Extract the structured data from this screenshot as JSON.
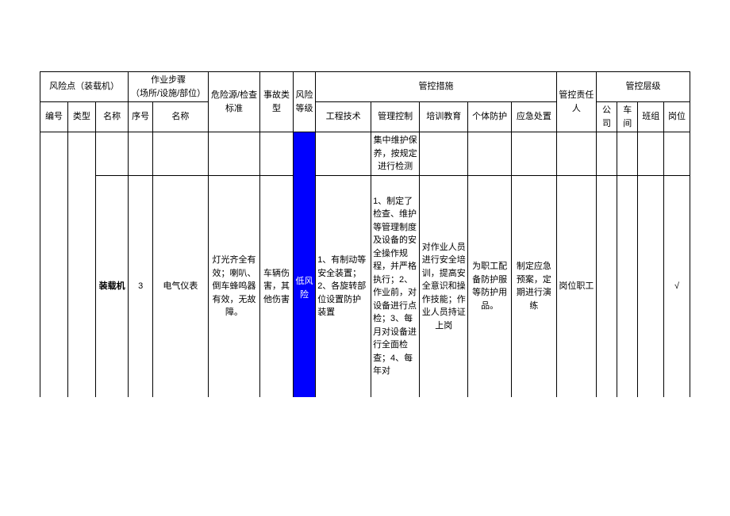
{
  "header": {
    "risk_point": "风险点（装载机）",
    "work_step": "作业步骤\n（场所/设施/部位）",
    "hazard": "危险源/检查标准",
    "accident_type": "事故类型",
    "risk_level": "风险等级",
    "control_measures": "管控措施",
    "responsible": "管控责任人",
    "control_level": "管控层级",
    "sub": {
      "no": "编号",
      "type": "类型",
      "name": "名称",
      "seq": "序号",
      "step_name": "名称",
      "eng_tech": "工程技术",
      "mgmt_ctrl": "管理控制",
      "training": "培训教育",
      "ppe": "个体防护",
      "emergency": "应急处置",
      "company": "公司",
      "workshop": "车间",
      "team": "班组",
      "post": "岗位"
    }
  },
  "rows": {
    "r1": {
      "mgmt_ctrl": "集中维护保养，按规定进行检测"
    },
    "r2": {
      "name": "装载机",
      "seq": "3",
      "step_name": "电气仪表",
      "hazard": "灯光齐全有效；喇叭、倒车蜂鸣器有效，无故障。",
      "accident_type": "车辆伤害，其他伤害",
      "risk_level": "低风险",
      "eng_tech": "1、有制动等安全装置；2、各旋转部位设置防护装置",
      "mgmt_ctrl": "1、制定了检查、维护等管理制度及设备的安全操作规程，并严格执行；2、作业前，对设备进行点检；3、每月对设备进行全面检查；4、每年对",
      "training": "对作业人员进行安全培训，提高安全意识和操作技能；作业人员持证上岗",
      "ppe": "为职工配备防护服等防护用品。",
      "emergency": "制定应急预案，定期进行演练",
      "responsible": "岗位职工",
      "post_check": "√"
    }
  }
}
